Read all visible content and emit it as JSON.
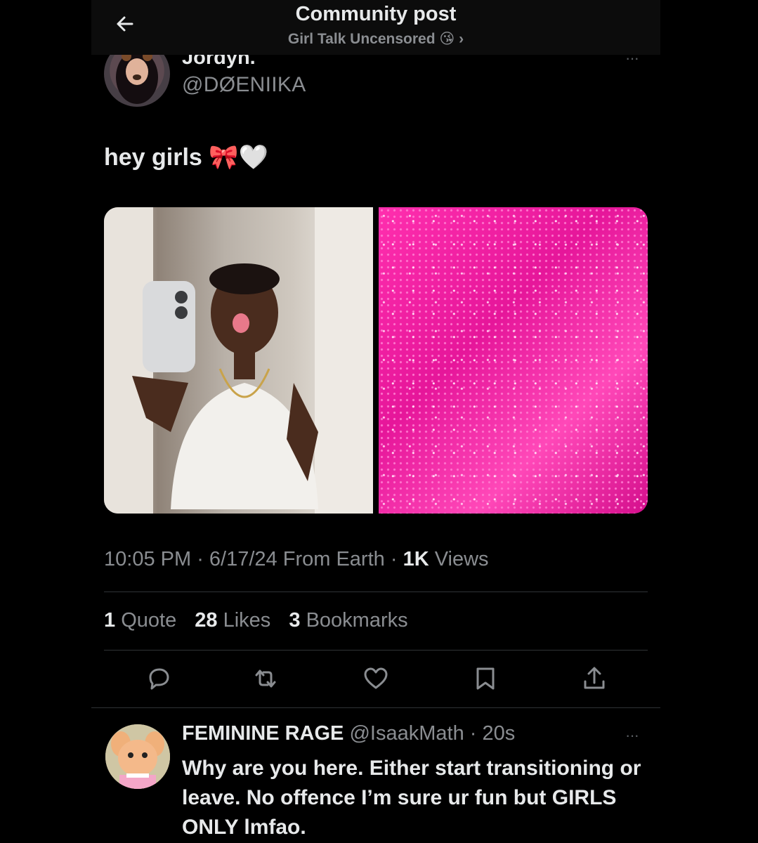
{
  "header": {
    "title": "Community post",
    "community": "Girl Talk Uncensored",
    "community_emoji": "😘",
    "chevron": "›"
  },
  "post": {
    "author_name": "Jordyn.",
    "author_handle": "@DØENIIKA",
    "text": "hey girls 🎀🤍",
    "time": "10:05 PM",
    "date": "6/17/24",
    "location": "From Earth",
    "views_count": "1K",
    "views_label": "Views",
    "quotes_count": "1",
    "quotes_label": "Quote",
    "likes_count": "28",
    "likes_label": "Likes",
    "bookmarks_count": "3",
    "bookmarks_label": "Bookmarks",
    "more": "···"
  },
  "reply": {
    "author_name": "FEMININE RAGE",
    "author_handle": "@IsaakMath",
    "age": "20s",
    "text": "Why are you here. Either start transitioning or leave. No offence I’m sure ur fun but GIRLS ONLY lmfao.",
    "more": "···"
  },
  "icons": [
    "back-arrow-icon",
    "reply-icon",
    "repost-icon",
    "like-icon",
    "bookmark-icon",
    "share-icon"
  ],
  "colors": {
    "background": "#000000",
    "text": "#e7e9ea",
    "secondary": "#8a8d91",
    "divider": "#2f3336",
    "glitter": "#ff2fae"
  }
}
